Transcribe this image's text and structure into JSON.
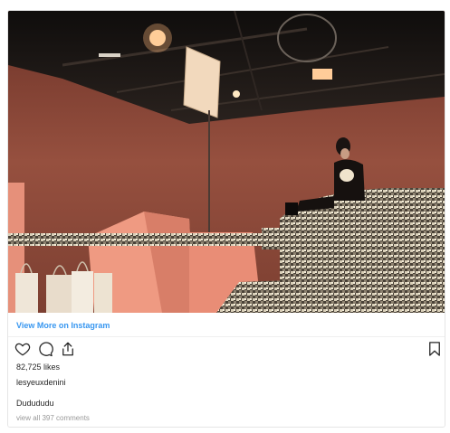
{
  "post": {
    "view_more_label": "View More on Instagram",
    "likes_text": "82,725 likes",
    "username": "lesyeuxdenini",
    "caption": "Dudududu",
    "comments_link": "view all 397 comments"
  },
  "icons": {
    "like": "heart-icon",
    "comment": "comment-icon",
    "share": "share-icon",
    "save": "bookmark-icon"
  },
  "colors": {
    "link": "#3897f0",
    "wall": "#8d4a3c",
    "muted": "#999999"
  }
}
